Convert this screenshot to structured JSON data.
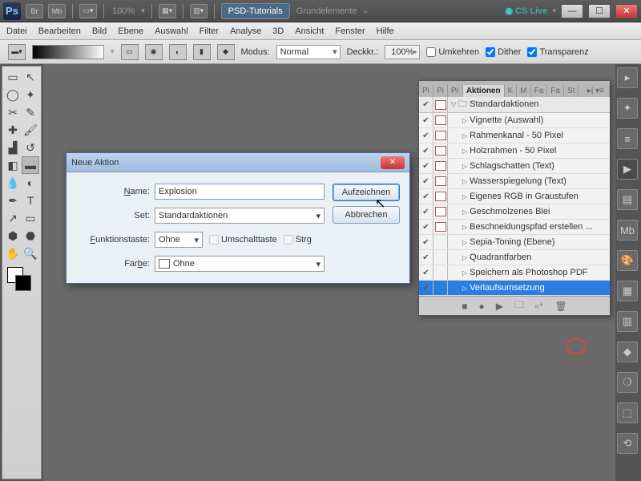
{
  "titlebar": {
    "zoom": "100%",
    "ws1": "PSD-Tutorials",
    "ws2": "Grundelemente",
    "cslive": "CS Live"
  },
  "menu": [
    "Datei",
    "Bearbeiten",
    "Bild",
    "Ebene",
    "Auswahl",
    "Filter",
    "Analyse",
    "3D",
    "Ansicht",
    "Fenster",
    "Hilfe"
  ],
  "optbar": {
    "modus_label": "Modus:",
    "modus_value": "Normal",
    "deck_label": "Deckkr.:",
    "deck_value": "100%",
    "umkehren": "Umkehren",
    "dither": "Dither",
    "transparenz": "Transparenz"
  },
  "dialog": {
    "title": "Neue Aktion",
    "name_label": "Name:",
    "name_value": "Explosion",
    "set_label": "Set:",
    "set_value": "Standardaktionen",
    "fn_label": "Funktionstaste:",
    "fn_value": "Ohne",
    "shift": "Umschalttaste",
    "ctrl": "Strg",
    "color_label": "Farbe:",
    "color_value": "Ohne",
    "record": "Aufzeichnen",
    "cancel": "Abbrechen"
  },
  "panel": {
    "tabs": [
      "Pi",
      "Pi",
      "Pr",
      "Aktionen",
      "K",
      "M",
      "Fa",
      "Fa",
      "St"
    ],
    "group": "Standardaktionen",
    "actions": [
      "Vignette (Auswahl)",
      "Rahmenkanal - 50 Pixel",
      "Holzrahmen - 50 Pixel",
      "Schlagschatten (Text)",
      "Wasserspiegelung (Text)",
      "Eigenes RGB in Graustufen",
      "Geschmolzenes Blei",
      "Beschneidungspfad erstellen ...",
      "Sepia-Toning (Ebene)",
      "Quadrantfarben",
      "Speichern als Photoshop PDF",
      "Verlaufsumsetzung"
    ],
    "selected_index": 11
  }
}
